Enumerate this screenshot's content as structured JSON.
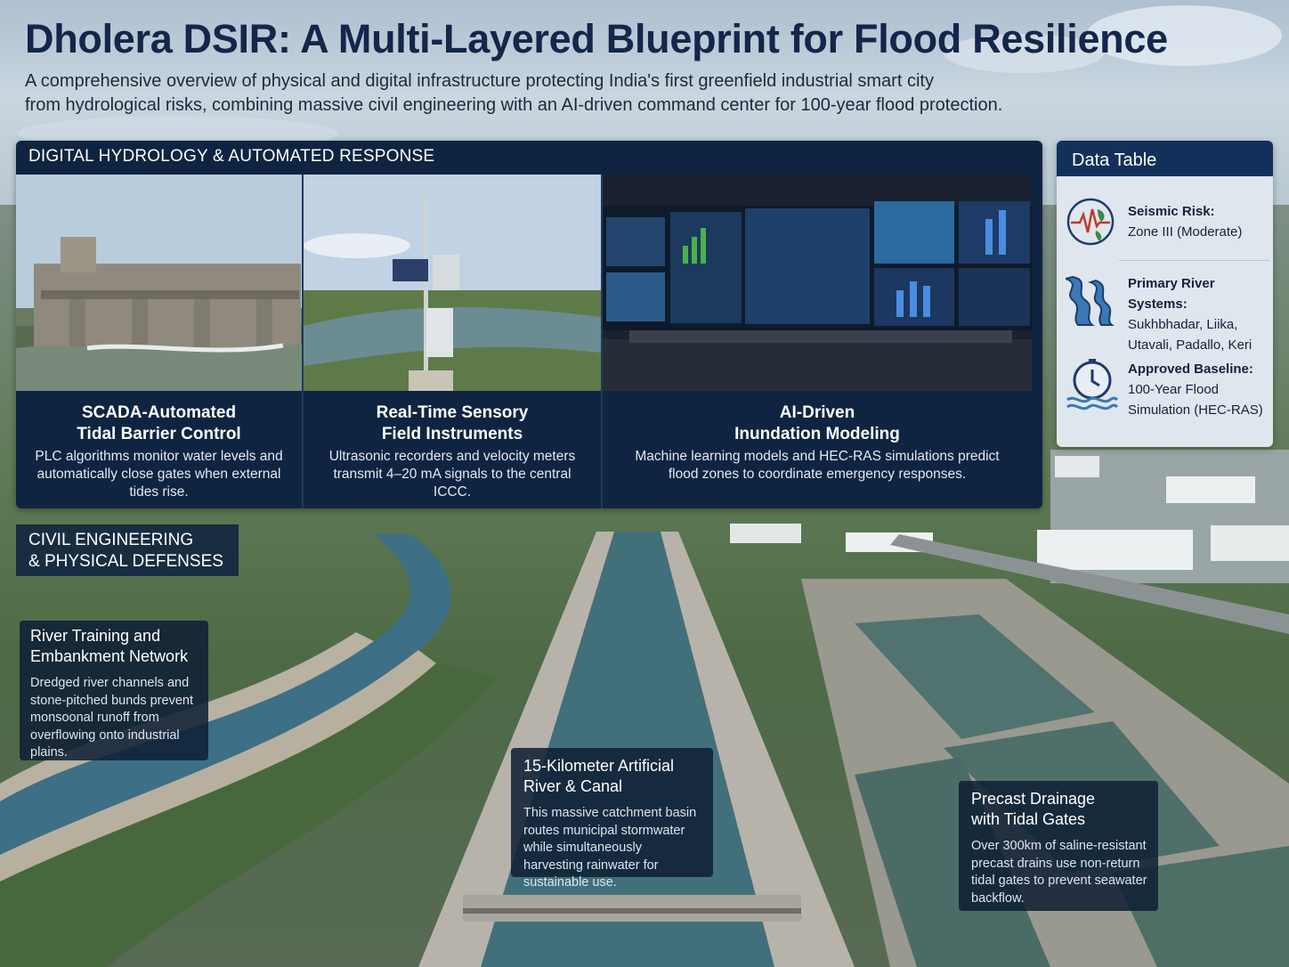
{
  "header": {
    "title": "Dholera DSIR: A Multi-Layered Blueprint for Flood Resilience",
    "subtitle_line1": "A comprehensive overview of physical and digital infrastructure protecting India's first greenfield industrial smart city",
    "subtitle_line2": "from hydrological risks, combining massive civil engineering with an AI-driven command center for 100-year flood protection."
  },
  "digital": {
    "section_title": "DIGITAL HYDROLOGY & AUTOMATED RESPONSE",
    "cards": [
      {
        "title_line1": "SCADA-Automated",
        "title_line2": "Tidal Barrier Control",
        "description": "PLC algorithms monitor water levels and automatically close gates when external tides rise."
      },
      {
        "title_line1": "Real-Time Sensory",
        "title_line2": "Field Instruments",
        "description": "Ultrasonic recorders and velocity meters transmit 4–20 mA signals to the central ICCC."
      },
      {
        "title_line1": "AI-Driven",
        "title_line2": "Inundation Modeling",
        "description": "Machine learning models and HEC-RAS simulations predict flood zones to coordinate emergency responses."
      }
    ]
  },
  "data_table": {
    "title": "Data Table",
    "rows": [
      {
        "icon": "seismic-icon",
        "label": "Seismic Risk:",
        "value_line1": "Zone III (Moderate)",
        "value_line2": ""
      },
      {
        "icon": "river-icon",
        "label": "Primary River Systems:",
        "value_line1": "Sukhbhadar, Liika,",
        "value_line2": "Utavali, Padallo, Keri"
      },
      {
        "icon": "flood-clock-icon",
        "label": "Approved Baseline:",
        "value_line1": "100-Year Flood",
        "value_line2": "Simulation (HEC-RAS)"
      }
    ]
  },
  "civil": {
    "section_title_line1": "CIVIL ENGINEERING",
    "section_title_line2": "& PHYSICAL DEFENSES",
    "river_box": {
      "title_line1": "River Training and",
      "title_line2": "Embankment Network",
      "description": "Dredged river channels and stone-pitched bunds prevent monsoonal runoff from overflowing onto industrial plains."
    },
    "canal_box": {
      "title_line1": "15-Kilometer Artificial",
      "title_line2": "River & Canal",
      "description": "This massive catchment basin routes municipal stormwater while simultaneously harvesting rainwater for sustainable use."
    },
    "drain_box": {
      "title_line1": "Precast Drainage",
      "title_line2": "with Tidal Gates",
      "description": "Over 300km of saline-resistant precast drains use non-return tidal gates to prevent seawater backflow."
    }
  },
  "colors": {
    "title": "#14264a",
    "panel_navy": "#0f2440",
    "table_header": "#13305a",
    "table_body": "#dfe6ee",
    "accent_red": "#c0392b",
    "accent_green": "#3a8a4a",
    "water_blue": "#3b78b4"
  }
}
